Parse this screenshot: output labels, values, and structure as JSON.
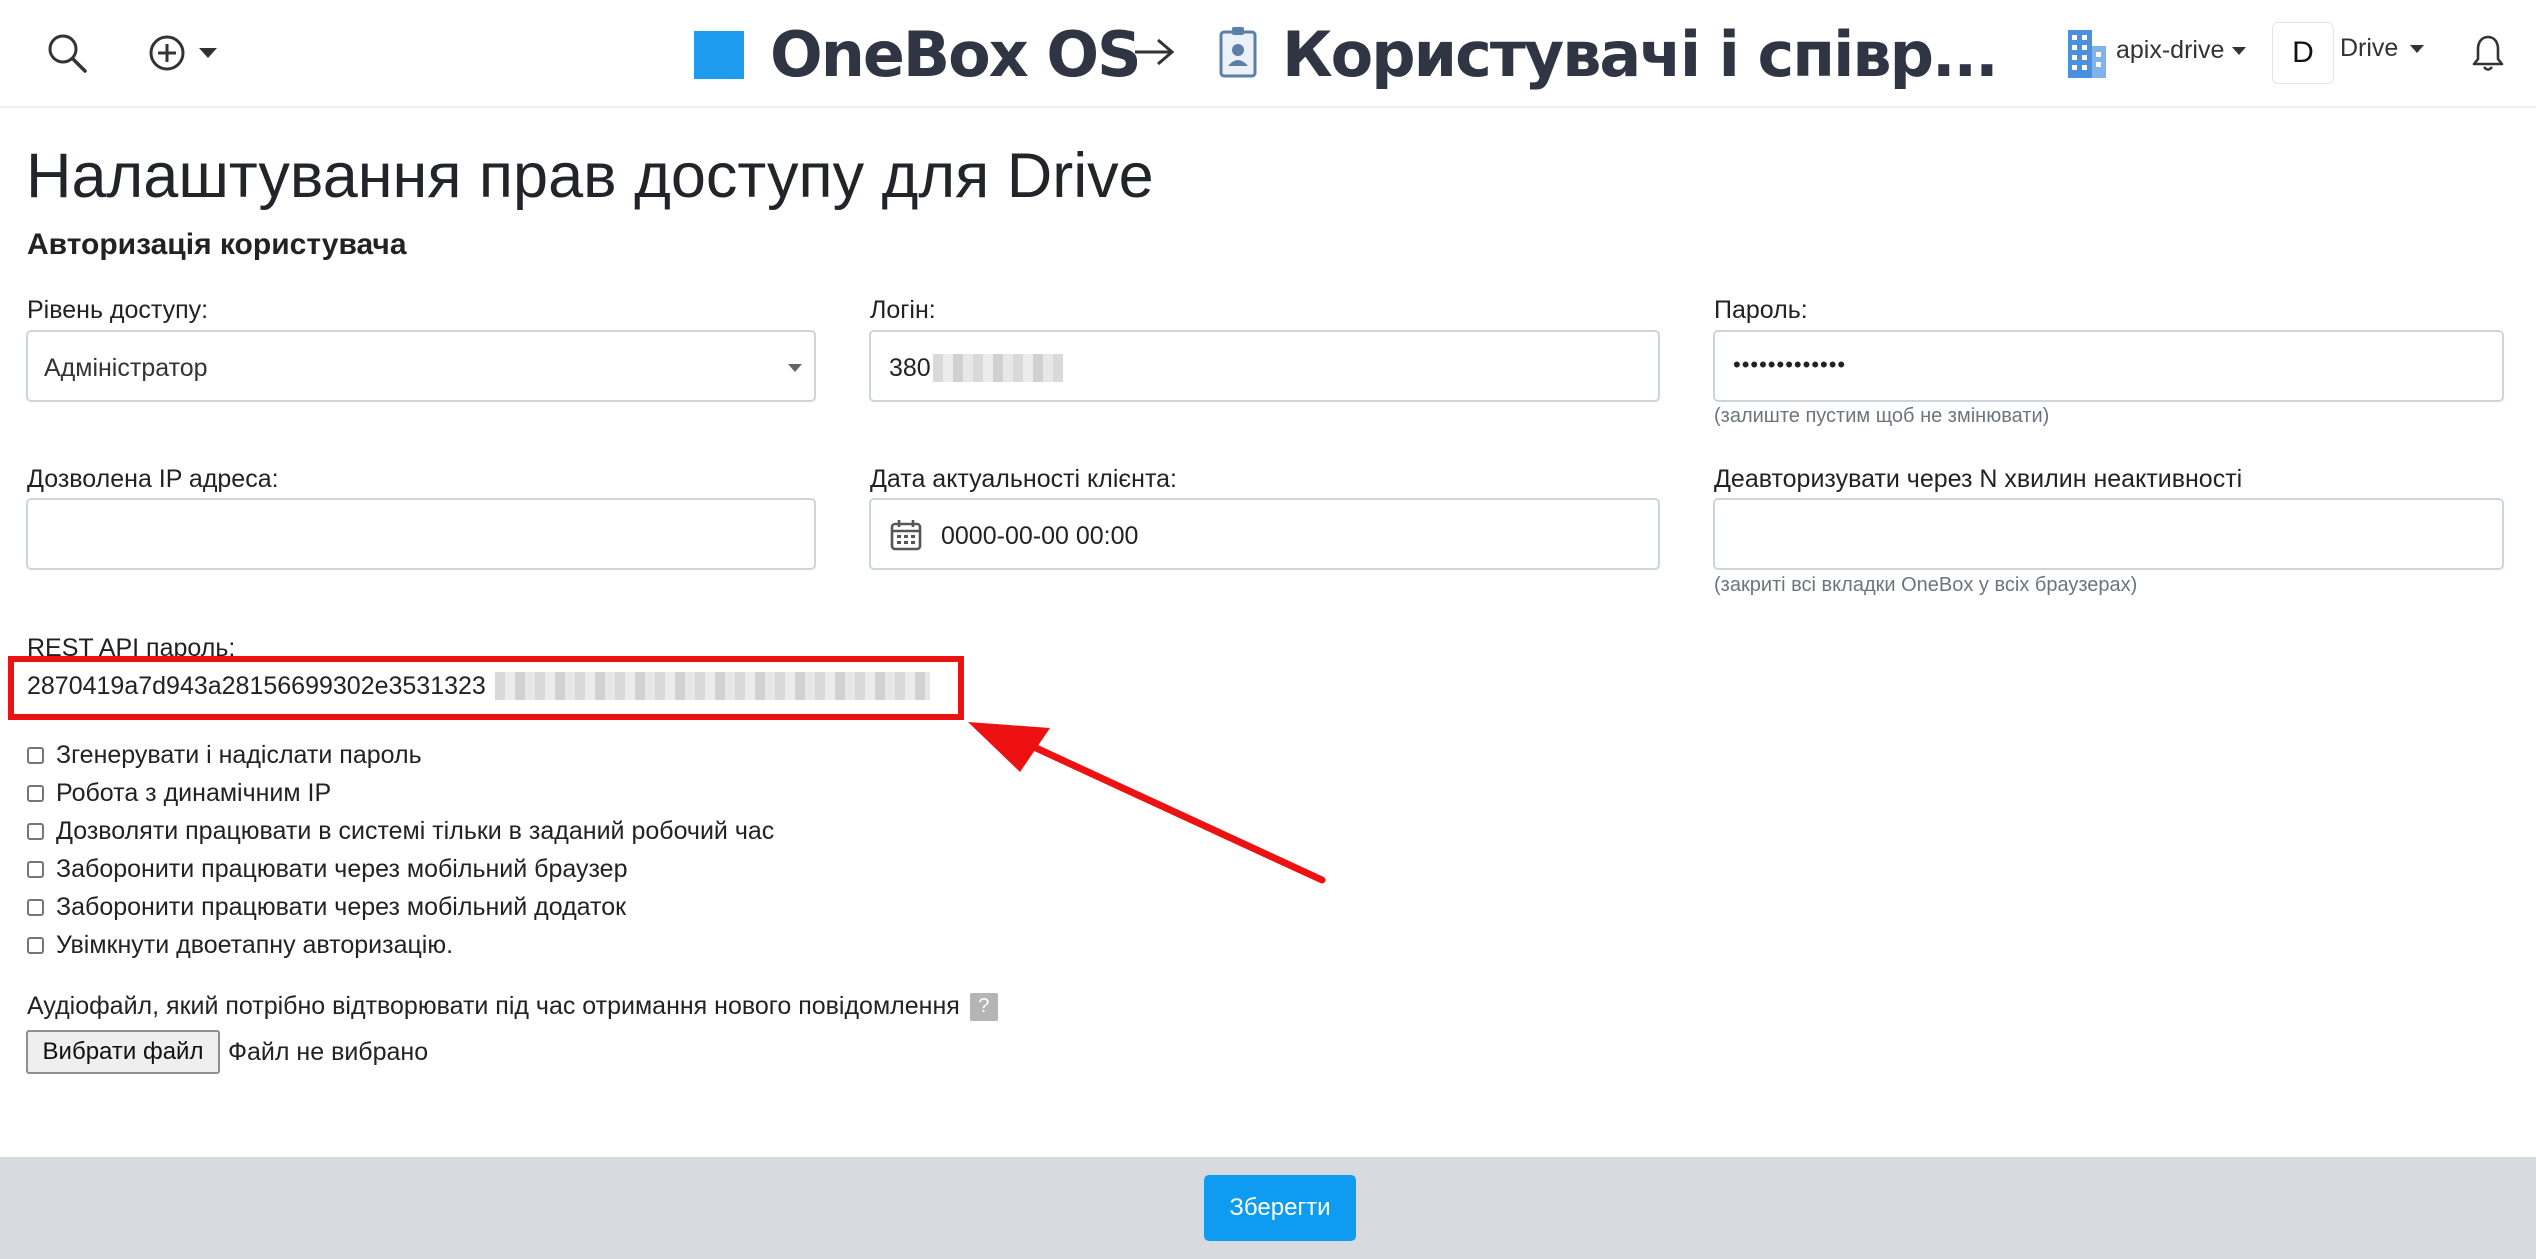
{
  "topbar": {
    "app_name": "OneBox OS",
    "page_name": "Користувачі і співр...",
    "account_name": "apix-drive",
    "user_initial": "D",
    "user_name": "Drive",
    "icons": {
      "search": "search-icon",
      "add": "plus-circle-icon",
      "arrow": "arrow-right-icon",
      "badge": "id-badge-icon",
      "building": "building-icon",
      "bell": "bell-icon"
    },
    "colors": {
      "app_square": "#1e9cf0",
      "badge": "#6c8fb3"
    }
  },
  "page": {
    "title": "Налаштування прав доступу для Drive",
    "section_title": "Авторизація користувача"
  },
  "fields": {
    "access_level": {
      "label": "Рівень доступу:",
      "value": "Адміністратор"
    },
    "login": {
      "label": "Логін:",
      "value": "380"
    },
    "password": {
      "label": "Пароль:",
      "value": "•••••••••••••",
      "hint": "(залиште пустим щоб не змінювати)"
    },
    "allowed_ip": {
      "label": "Дозволена IP адреса:",
      "value": ""
    },
    "client_date": {
      "label": "Дата актуальності клієнта:",
      "value": "0000-00-00 00:00"
    },
    "deauth": {
      "label": "Деавторизувати через N хвилин неактивності",
      "value": "",
      "hint": "(закриті всі вкладки OneBox у всіх браузерах)"
    },
    "rest_api": {
      "label": "REST API пароль:",
      "value": "2870419a7d943a28156699302e3531323"
    }
  },
  "checkboxes": [
    {
      "label": "Згенерувати і надіслати пароль",
      "checked": false
    },
    {
      "label": "Робота з динамічним IP",
      "checked": false
    },
    {
      "label": "Дозволяти працювати в системі тільки в заданий робочий час",
      "checked": false
    },
    {
      "label": "Заборонити працювати через мобільний браузер",
      "checked": false
    },
    {
      "label": "Заборонити працювати через мобільний додаток",
      "checked": false
    },
    {
      "label": "Увімкнути двоетапну авторизацію.",
      "checked": false
    }
  ],
  "audio": {
    "label": "Аудіофайл, який потрібно відтворювати під час отримання нового повідомлення",
    "help": "?",
    "choose_button": "Вибрати файл",
    "no_file": "Файл не вибрано"
  },
  "footer": {
    "save_label": "Зберегти",
    "save_color": "#0d9cf2"
  },
  "annotation": {
    "color": "#ee1111"
  }
}
